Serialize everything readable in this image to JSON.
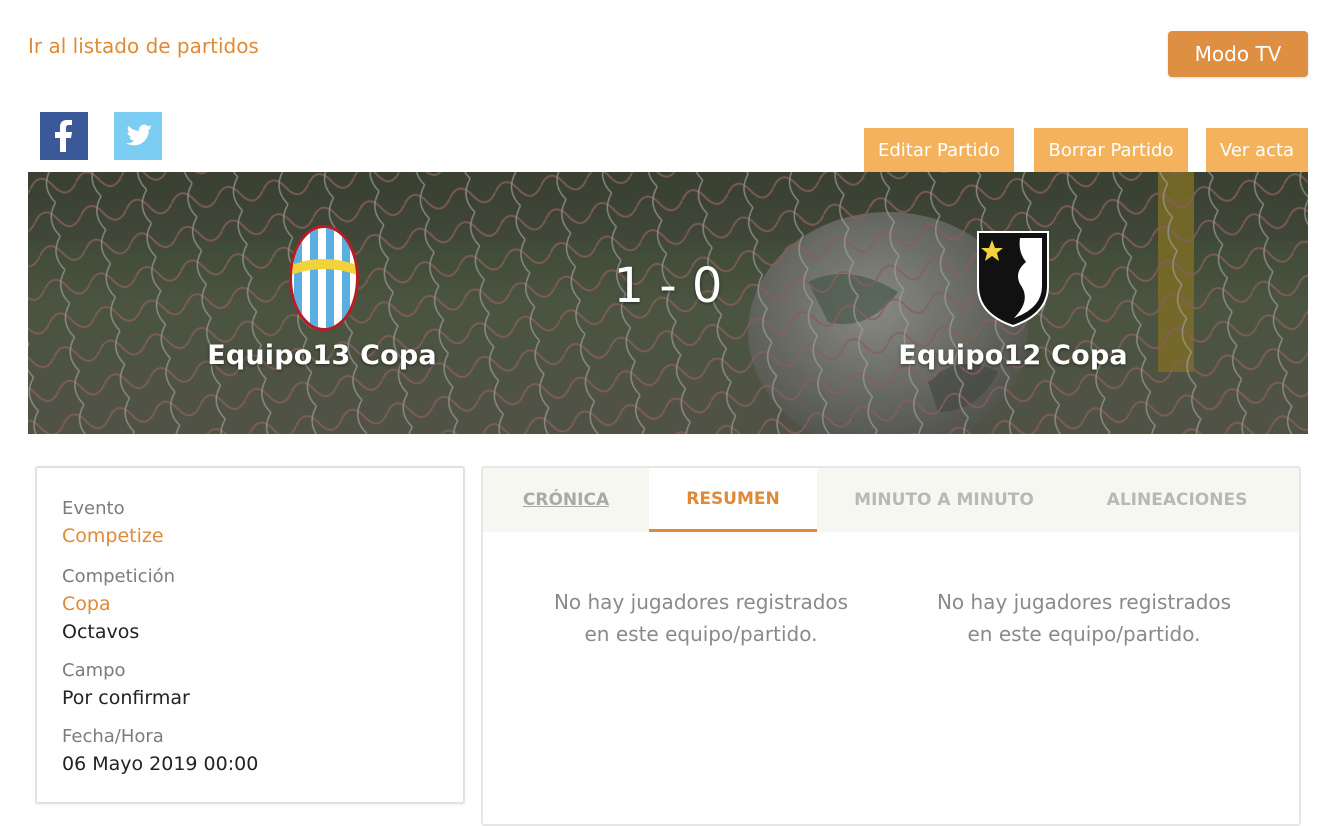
{
  "nav": {
    "back_link": "Ir al listado de partidos",
    "tv_mode": "Modo TV"
  },
  "social": {
    "facebook_icon": "facebook-icon",
    "twitter_icon": "twitter-icon"
  },
  "actions": {
    "edit": "Editar Partido",
    "delete": "Borrar Partido",
    "acta": "Ver acta"
  },
  "match": {
    "home_team": "Equipo13 Copa",
    "away_team": "Equipo12 Copa",
    "score": "1 - 0"
  },
  "info": {
    "event_label": "Evento",
    "event_value": "Competize",
    "competition_label": "Competición",
    "competition_value": "Copa",
    "round_value": "Octavos",
    "field_label": "Campo",
    "field_value": "Por confirmar",
    "datetime_label": "Fecha/Hora",
    "datetime_value": "06 Mayo 2019 00:00"
  },
  "tabs": {
    "cronica": "CRÓNICA",
    "resumen": "RESUMEN",
    "minuto": "MINUTO A MINUTO",
    "alineaciones": "ALINEACIONES",
    "active": "RESUMEN"
  },
  "summary": {
    "home_empty_line1": "No hay jugadores registrados",
    "home_empty_line2": "en este equipo/partido.",
    "away_empty_line1": "No hay jugadores registrados",
    "away_empty_line2": "en este equipo/partido."
  },
  "colors": {
    "accent": "#e08a37",
    "button_light": "#f5b25d",
    "facebook": "#3b5998",
    "twitter": "#7ccdf3"
  }
}
